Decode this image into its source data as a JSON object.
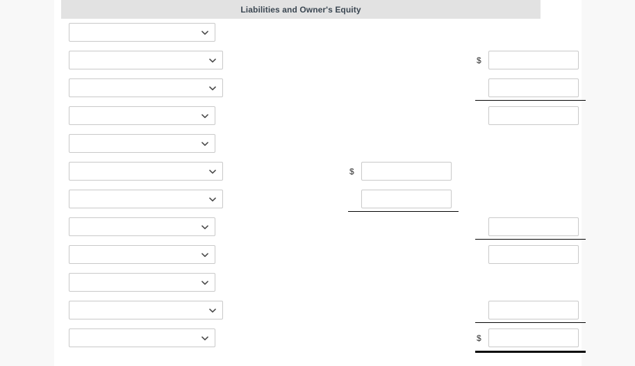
{
  "page": {
    "background_color": "#f8f8f8",
    "panel_color": "#ffffff"
  },
  "section": {
    "title": "Liabilities and Owner's Equity",
    "header_bg": "#e2e2e2",
    "title_color": "#3a4651"
  },
  "icons": {
    "dropdown_chevron": "chevron-down-icon"
  },
  "currency_symbol": "$",
  "form": {
    "select_placeholder": "",
    "amount_placeholder": "",
    "rows": [
      {
        "index": 1,
        "select": {
          "width": "narrow",
          "value": ""
        },
        "middle": null,
        "right": null
      },
      {
        "index": 2,
        "select": {
          "width": "wide",
          "value": ""
        },
        "middle": null,
        "right": {
          "dollar": true,
          "value": ""
        }
      },
      {
        "index": 3,
        "select": {
          "width": "wide",
          "value": ""
        },
        "middle": null,
        "right": {
          "dollar": false,
          "value": ""
        },
        "rule_after_right": "thin"
      },
      {
        "index": 4,
        "select": {
          "width": "narrow",
          "value": ""
        },
        "middle": null,
        "right": {
          "dollar": false,
          "value": ""
        }
      },
      {
        "index": 5,
        "select": {
          "width": "narrow",
          "value": ""
        },
        "middle": null,
        "right": null
      },
      {
        "index": 6,
        "select": {
          "width": "wide",
          "value": ""
        },
        "middle": {
          "dollar": true,
          "value": ""
        },
        "right": null
      },
      {
        "index": 7,
        "select": {
          "width": "wide",
          "value": ""
        },
        "middle": {
          "dollar": false,
          "value": ""
        },
        "right": null,
        "rule_after_middle": "thin"
      },
      {
        "index": 8,
        "select": {
          "width": "narrow",
          "value": ""
        },
        "middle": null,
        "right": {
          "dollar": false,
          "value": ""
        },
        "rule_after_right": "thin"
      },
      {
        "index": 9,
        "select": {
          "width": "narrow",
          "value": ""
        },
        "middle": null,
        "right": {
          "dollar": false,
          "value": ""
        }
      },
      {
        "index": 10,
        "select": {
          "width": "narrow",
          "value": ""
        },
        "middle": null,
        "right": null
      },
      {
        "index": 11,
        "select": {
          "width": "wide",
          "value": ""
        },
        "middle": null,
        "right": {
          "dollar": false,
          "value": ""
        },
        "rule_after_right": "thin"
      },
      {
        "index": 12,
        "select": {
          "width": "narrow",
          "value": ""
        },
        "middle": null,
        "right": {
          "dollar": true,
          "value": ""
        },
        "rule_after_right": "thick"
      }
    ]
  }
}
